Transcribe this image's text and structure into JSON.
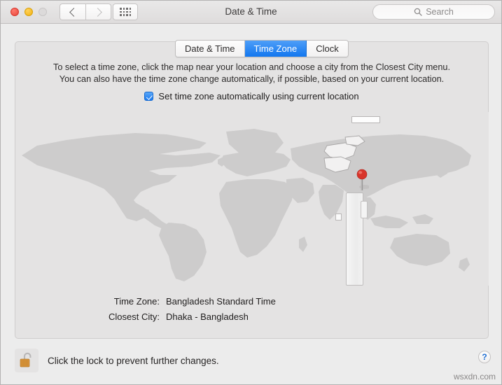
{
  "window": {
    "title": "Date & Time",
    "traffic_lights": [
      "close",
      "minimize",
      "zoom"
    ],
    "nav_back_icon": "chevron-left-icon",
    "nav_forward_icon": "chevron-right-icon",
    "show_all_icon": "grid-icon"
  },
  "search": {
    "placeholder": "Search",
    "icon": "search-icon"
  },
  "tabs": [
    {
      "label": "Date & Time",
      "selected": false
    },
    {
      "label": "Time Zone",
      "selected": true
    },
    {
      "label": "Clock",
      "selected": false
    }
  ],
  "description": {
    "line1": "To select a time zone, click the map near your location and choose a city from the Closest City menu.",
    "line2": "You can also have the time zone change automatically, if possible, based on your current location."
  },
  "auto_timezone": {
    "label": "Set time zone automatically using current location",
    "checked": true
  },
  "map": {
    "pin_icon": "map-pin-icon",
    "pin_location": "Bangladesh",
    "highlight_band": "selected-timezone-band"
  },
  "info": [
    {
      "label": "Time Zone:",
      "value": "Bangladesh Standard Time"
    },
    {
      "label": "Closest City:",
      "value": "Dhaka - Bangladesh"
    }
  ],
  "footer": {
    "lock_icon": "unlocked-padlock-icon",
    "lock_text": "Click the lock to prevent further changes.",
    "help_label": "?",
    "watermark": "wsxdn.com"
  },
  "colors": {
    "accent_blue": "#1277ef",
    "pin_red": "#d8342a",
    "lock_gold": "#d9933a",
    "map_land": "#cdcccc",
    "map_sea": "#e4e3e3"
  }
}
